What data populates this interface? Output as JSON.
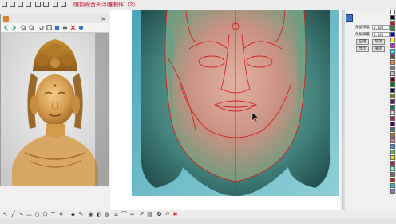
{
  "app": {
    "title": "雕刻观音头浮雕制作（2）"
  },
  "viewer": {
    "title": ""
  },
  "panel": {
    "field1_label": "保留深度",
    "field1_value": "0.000",
    "field2_label": "保留高度",
    "field2_value": "0.000",
    "btn_apply": "应用",
    "btn_cancel": "取消",
    "btn_ok": "显示",
    "btn_close": "关闭"
  },
  "palette": [
    "#ffffff",
    "#000000",
    "#ff0000",
    "#00aa00",
    "#0000ff",
    "#ffff00",
    "#ff00ff",
    "#00ffff",
    "#8b4513",
    "#ff8c00",
    "#808080",
    "#c0c0c0",
    "#800000",
    "#008000",
    "#000080",
    "#808000",
    "#800080",
    "#008080",
    "#ffc0cb",
    "#a52a2a",
    "#4b0082",
    "#2e8b57",
    "#d2691e",
    "#ff69b4",
    "#1e90ff",
    "#32cd32",
    "#ffd700",
    "#dc143c",
    "#7fffd4",
    "#696969",
    "#b22222",
    "#00ced1",
    "#9370db"
  ],
  "colors": {
    "title_red": "#c8102e",
    "relief_bg": "#6fb7c7",
    "face_green": "#5fa48a",
    "face_skin": "#d7a496",
    "outline_red": "#d42020"
  }
}
